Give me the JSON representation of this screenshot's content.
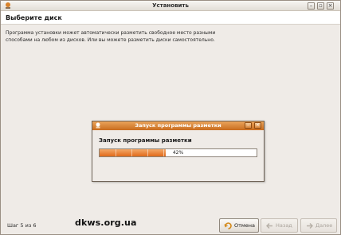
{
  "window": {
    "title": "Установить",
    "controls": [
      "minimize",
      "maximize",
      "close"
    ]
  },
  "header": {
    "title": "Выберите диск"
  },
  "description": {
    "line1": "Программа установки может автоматически разметить свободное место разными",
    "line2": "способами на любом из дисков. Или вы можете разметить диски самостоятельно."
  },
  "dialog": {
    "title": "Запуск программы разметки",
    "heading": "Запуск программы разметки",
    "progress_fraction": 0.42,
    "progress_text": "42%"
  },
  "footer": {
    "step_text": "Шаг 5 из 6",
    "watermark": "dkws.org.ua",
    "cancel_label": "Отмена",
    "back_label": "Назад",
    "forward_label": "Далее"
  },
  "colors": {
    "window_bg": "#efebe7",
    "dialog_title_bg": "#d27a2c",
    "progress_fill": "#e8782a"
  }
}
